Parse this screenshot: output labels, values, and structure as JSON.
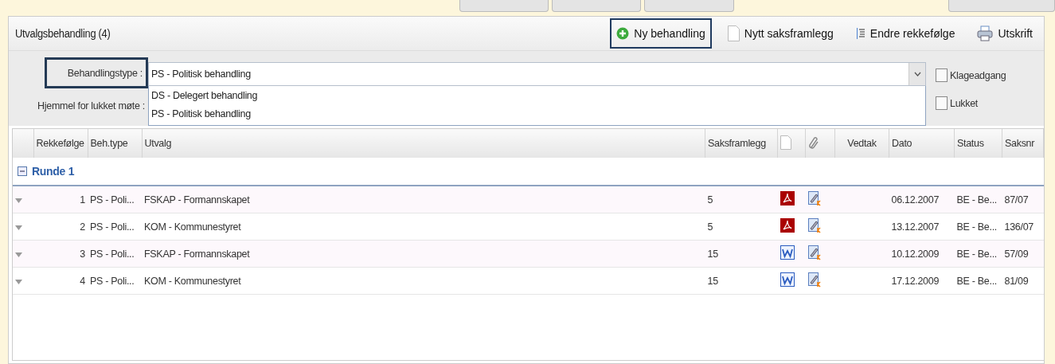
{
  "panel": {
    "title": "Utvalgsbehandling (4)"
  },
  "toolbar": [
    {
      "kind": "add",
      "label": "Ny behandling",
      "selected": true
    },
    {
      "kind": "document",
      "label": "Nytt saksframlegg",
      "selected": false
    },
    {
      "kind": "order",
      "label": "Endre rekkefølge",
      "selected": false
    },
    {
      "kind": "print",
      "label": "Utskrift",
      "selected": false
    }
  ],
  "form": {
    "type_label": "Behandlingstype :",
    "type_value": "PS - Politisk behandling",
    "type_label_selected": true,
    "hjemmel_label": "Hjemmel for lukket møte :",
    "dropdown_options": [
      "DS - Delegert behandling",
      "PS - Politisk behandling"
    ],
    "checkboxes": [
      {
        "label": "Klageadgang",
        "checked": false
      },
      {
        "label": "Lukket",
        "checked": false
      }
    ]
  },
  "table": {
    "columns": [
      "Rekkefølge",
      "Beh.type",
      "Utvalg",
      "Saksframlegg",
      "Vedtak",
      "Dato",
      "Status",
      "Saksnr"
    ],
    "group": {
      "label": "Runde 1",
      "expanded": true
    },
    "rows": [
      {
        "order": "1",
        "type": "PS - Poli...",
        "utvalg": "FSKAP - Formannskapet",
        "saksframlegg": "5",
        "kind": "pdf",
        "dato": "06.12.2007",
        "status": "BE - Be...",
        "saksnr": "87/07"
      },
      {
        "order": "2",
        "type": "PS - Poli...",
        "utvalg": "KOM - Kommunestyret",
        "saksframlegg": "5",
        "kind": "pdf",
        "dato": "13.12.2007",
        "status": "BE - Be...",
        "saksnr": "136/07"
      },
      {
        "order": "3",
        "type": "PS - Poli...",
        "utvalg": "FSKAP - Formannskapet",
        "saksframlegg": "15",
        "kind": "word",
        "dato": "10.12.2009",
        "status": "BE - Be...",
        "saksnr": "57/09"
      },
      {
        "order": "4",
        "type": "PS - Poli...",
        "utvalg": "KOM - Kommunestyret",
        "saksframlegg": "15",
        "kind": "word",
        "dato": "17.12.2009",
        "status": "BE - Be...",
        "saksnr": "81/09"
      }
    ]
  }
}
